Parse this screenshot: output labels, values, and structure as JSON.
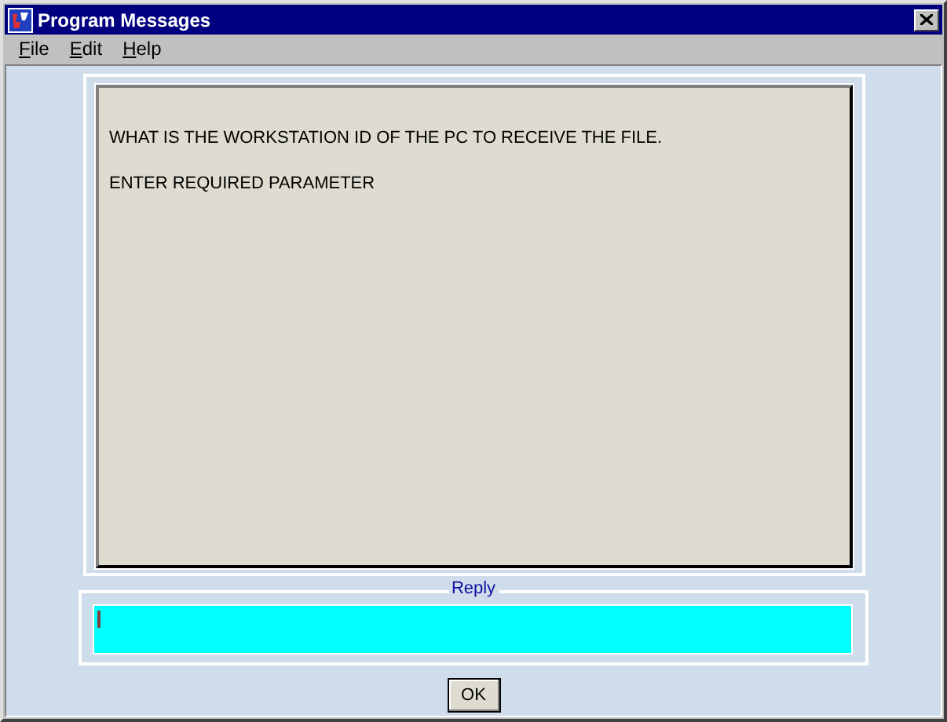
{
  "window": {
    "title": "Program Messages"
  },
  "menu": [
    {
      "label": "File"
    },
    {
      "label": "Edit"
    },
    {
      "label": "Help"
    }
  ],
  "messages": [
    "WHAT IS THE WORKSTATION ID OF THE PC TO RECEIVE THE FILE.",
    "ENTER REQUIRED PARAMETER"
  ],
  "reply": {
    "label": "Reply",
    "focused": true
  },
  "buttons": [
    "OK"
  ]
}
